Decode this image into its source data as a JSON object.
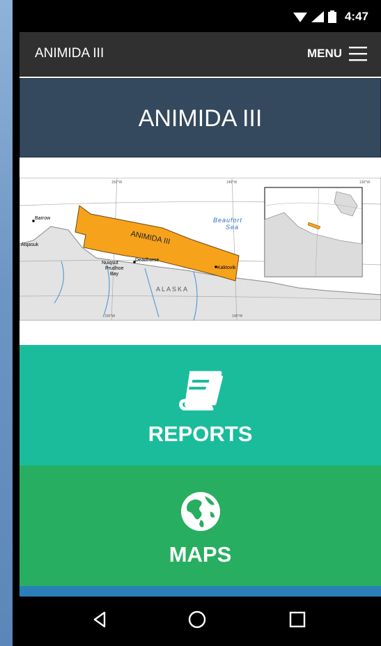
{
  "status": {
    "time": "4:47"
  },
  "appbar": {
    "title": "ANIMIDA III",
    "menu_label": "MENU"
  },
  "banner": {
    "title": "ANIMIDA III"
  },
  "map": {
    "labels": {
      "barrow": "Barrow",
      "atqasuk": "Atqasuk",
      "nuiqsut": "Nuiqsut",
      "prudhoe": "Prudhoe",
      "bay": "Bay",
      "deadhorse": "Deadhorse",
      "kaktovik": "Kaktovik",
      "beaufort": "Beaufort",
      "sea": "Sea",
      "alaska": "ALASKA",
      "animida": "ANIMIDA III",
      "lon150_top": "150°W",
      "lon145_top": "145°W",
      "lon150_bot": "150°W",
      "lon145_bot": "145°W",
      "lon130": "130°W"
    },
    "colors": {
      "study_area": "#f7a21b",
      "land": "#e6e6e6",
      "water": "#ffffff"
    }
  },
  "tiles": [
    {
      "label": "REPORTS",
      "icon": "book-icon",
      "color": "#1abc9c"
    },
    {
      "label": "MAPS",
      "icon": "globe-icon",
      "color": "#27ae60"
    }
  ],
  "nav": {
    "icons": [
      "back-icon",
      "home-icon",
      "recents-icon"
    ]
  }
}
